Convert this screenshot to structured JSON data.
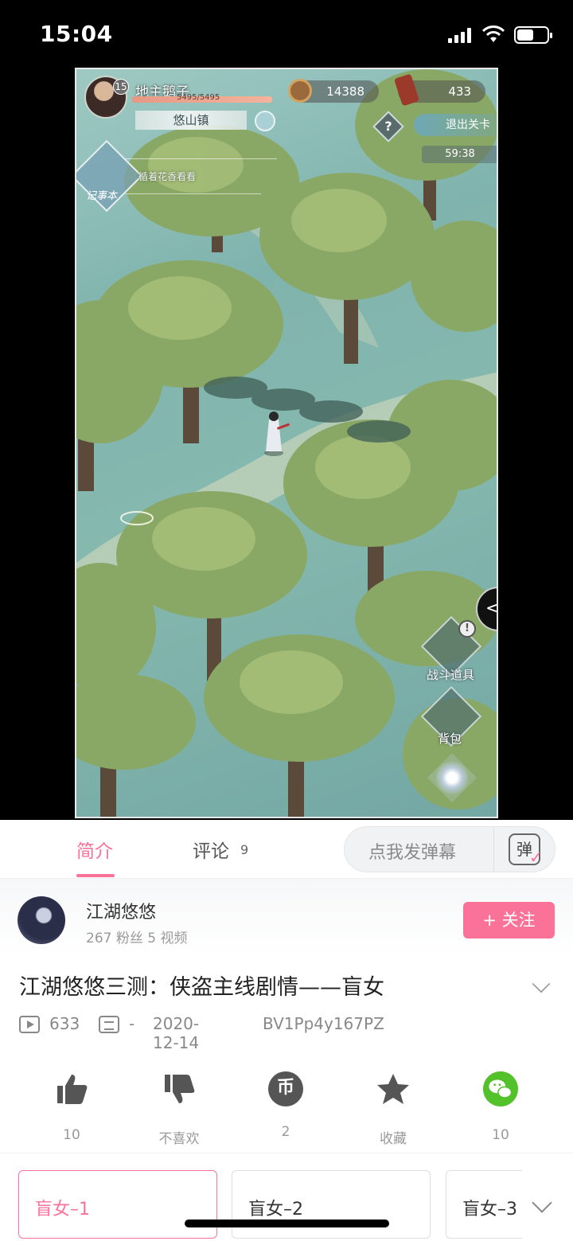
{
  "status_bar": {
    "time": "15:04",
    "battery_level": 0.55
  },
  "game": {
    "player_level": "15",
    "player_name": "地主鹅子",
    "hp_text": "5495/5495",
    "location": "悠山镇",
    "coins": "14388",
    "tokens": "433",
    "help": "?",
    "exit_label": "退出关卡",
    "timer": "59:38",
    "journal_label": "记事本",
    "quest_text": "循着花香看看",
    "side_arrow": "<",
    "items_badge": "!",
    "items_label": "战斗道具",
    "bag_label": "背包"
  },
  "tabs": {
    "intro": "简介",
    "comments": "评论",
    "comments_count": "9"
  },
  "danmaku": {
    "placeholder": "点我发弹幕",
    "icon_char": "弹"
  },
  "uploader": {
    "name": "江湖悠悠",
    "stats": "267 粉丝  5 视频",
    "follow_label": "+ 关注"
  },
  "video": {
    "title": "江湖悠悠三测：侠盗主线剧情——盲女",
    "views": "633",
    "danmaku_count": "-",
    "date": "2020-12-14",
    "bvid": "BV1Pp4y167PZ"
  },
  "actions": {
    "like": "10",
    "dislike": "不喜欢",
    "coin": "2",
    "coin_char": "币",
    "favorite": "收藏",
    "share": "10"
  },
  "episodes": [
    "盲女–1",
    "盲女–2",
    "盲女–3"
  ],
  "colors": {
    "accent": "#fb7299",
    "wechat": "#52c12a"
  }
}
